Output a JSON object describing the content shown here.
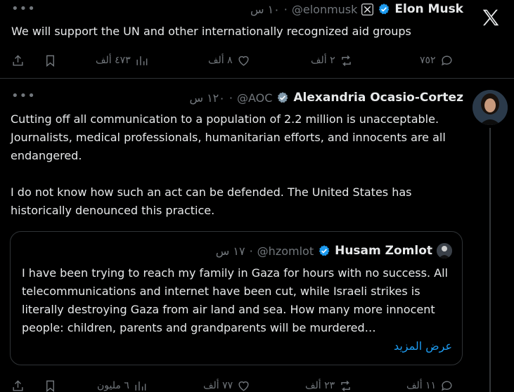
{
  "tweet1": {
    "author_name": "Elon Musk",
    "handle": "@elonmusk",
    "time": "١٠ س",
    "text": "We will support the UN and other internationally recognized aid groups",
    "stats": {
      "replies": "٧٥٢",
      "reposts": "٢ ألف",
      "likes": "٨ ألف",
      "views": "٤٧٣ ألف"
    }
  },
  "tweet2": {
    "author_name": "Alexandria Ocasio-Cortez",
    "handle": "@AOC",
    "time": "١٢٠ س",
    "text": "Cutting off all communication to a population of 2.2 million is unacceptable. Journalists, medical professionals, humanitarian efforts, and innocents are all endangered.\n\nI do not know how such an act can be defended. The United States has historically denounced this practice.",
    "stats": {
      "replies": "١١ ألف",
      "reposts": "٢٣ ألف",
      "likes": "٧٧ ألف",
      "views": "٦ مليون"
    }
  },
  "quote": {
    "author_name": "Husam Zomlot",
    "handle": "@hzomlot",
    "time": "١٧ س",
    "text": "I have been trying to reach my family in Gaza for hours with no success. All telecommunications and internet have been cut, while Israeli strikes is literally destroying Gaza from air land and sea. How many more innocent people: children, parents and grandparents will be murdered…",
    "show_more": "عرض المزيد"
  },
  "colors": {
    "background": "#000000",
    "text": "#e7e9ea",
    "muted": "#71767b",
    "accent": "#1d9bf0",
    "border": "#2f3336"
  },
  "icons": [
    "x-logo-icon",
    "verified-badge-icon",
    "affiliate-x-badge-icon",
    "more-icon",
    "reply-icon",
    "repost-icon",
    "like-icon",
    "views-icon",
    "bookmark-icon",
    "share-icon"
  ]
}
